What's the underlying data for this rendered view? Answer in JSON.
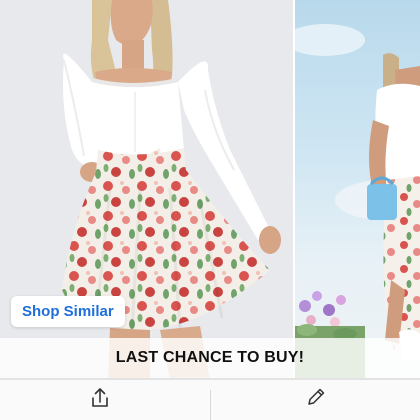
{
  "product": {
    "shop_similar_label": "Shop Similar",
    "banner_text": "LAST CHANCE TO BUY!"
  },
  "icons": {
    "share": "share-icon",
    "edit": "pencil-icon"
  },
  "colors": {
    "accent": "#1e6fd9",
    "banner_text": "#111111"
  }
}
